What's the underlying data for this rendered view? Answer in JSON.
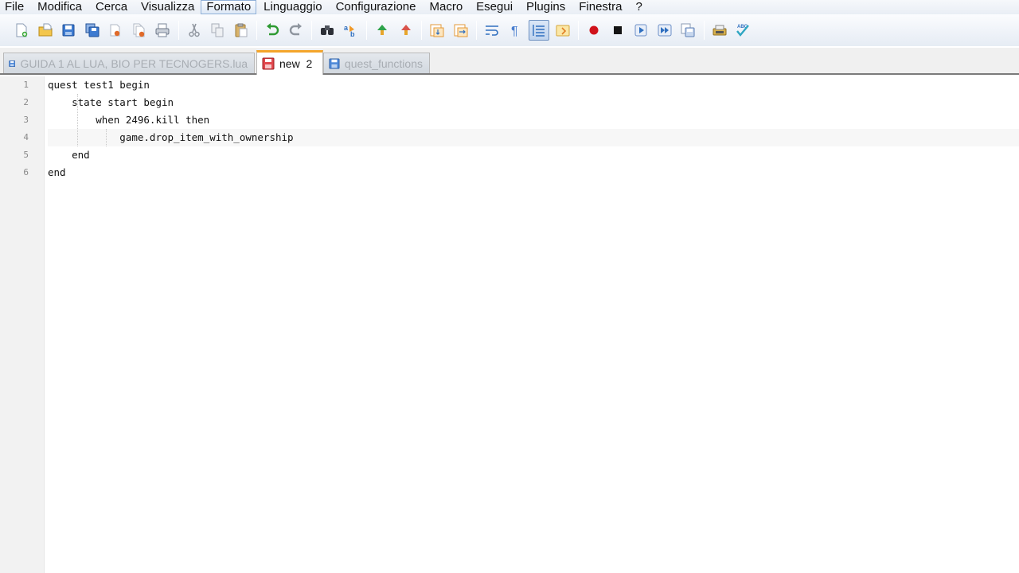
{
  "menu": [
    "File",
    "Modifica",
    "Cerca",
    "Visualizza",
    "Formato",
    "Linguaggio",
    "Configurazione",
    "Macro",
    "Esegui",
    "Plugins",
    "Finestra",
    "?"
  ],
  "toolbar": {
    "icons": [
      "new-file-icon",
      "open-file-icon",
      "save-icon",
      "save-all-icon",
      "close-icon",
      "close-all-icon",
      "print-icon",
      "cut-icon",
      "copy-icon",
      "paste-icon",
      "undo-icon",
      "redo-icon",
      "find-icon",
      "replace-icon",
      "zoom-in-icon",
      "zoom-out-icon",
      "sync-vertical-icon",
      "sync-horizontal-icon",
      "word-wrap-icon",
      "show-all-chars-icon",
      "indent-guide-icon",
      "user-defined-lang-icon",
      "macro-record-icon",
      "macro-stop-icon",
      "macro-play-icon",
      "macro-run-multiple-icon",
      "macro-save-icon",
      "plugin-icon",
      "spell-check-icon"
    ],
    "spell_label": "ABC"
  },
  "tabs": [
    {
      "label": "GUIDA 1 AL LUA, BIO PER TECNOGERS.lua",
      "state": "saved"
    },
    {
      "label": "new  2",
      "state": "unsaved",
      "active": true
    },
    {
      "label": "quest_functions",
      "state": "saved"
    }
  ],
  "editor": {
    "current_line": 4,
    "lines": [
      {
        "number": "1",
        "text": "quest test1 begin"
      },
      {
        "number": "2",
        "text": "    state start begin"
      },
      {
        "number": "3",
        "text": "        when 2496.kill then"
      },
      {
        "number": "4",
        "text": "            game.drop_item_with_ownership"
      },
      {
        "number": "5",
        "text": "    end"
      },
      {
        "number": "6",
        "text": "end"
      }
    ]
  },
  "colors": {
    "active_tab_accent": "#f4a52a",
    "macro_record": "#d0121b",
    "toolbar_blue": "#2f6fbf"
  }
}
